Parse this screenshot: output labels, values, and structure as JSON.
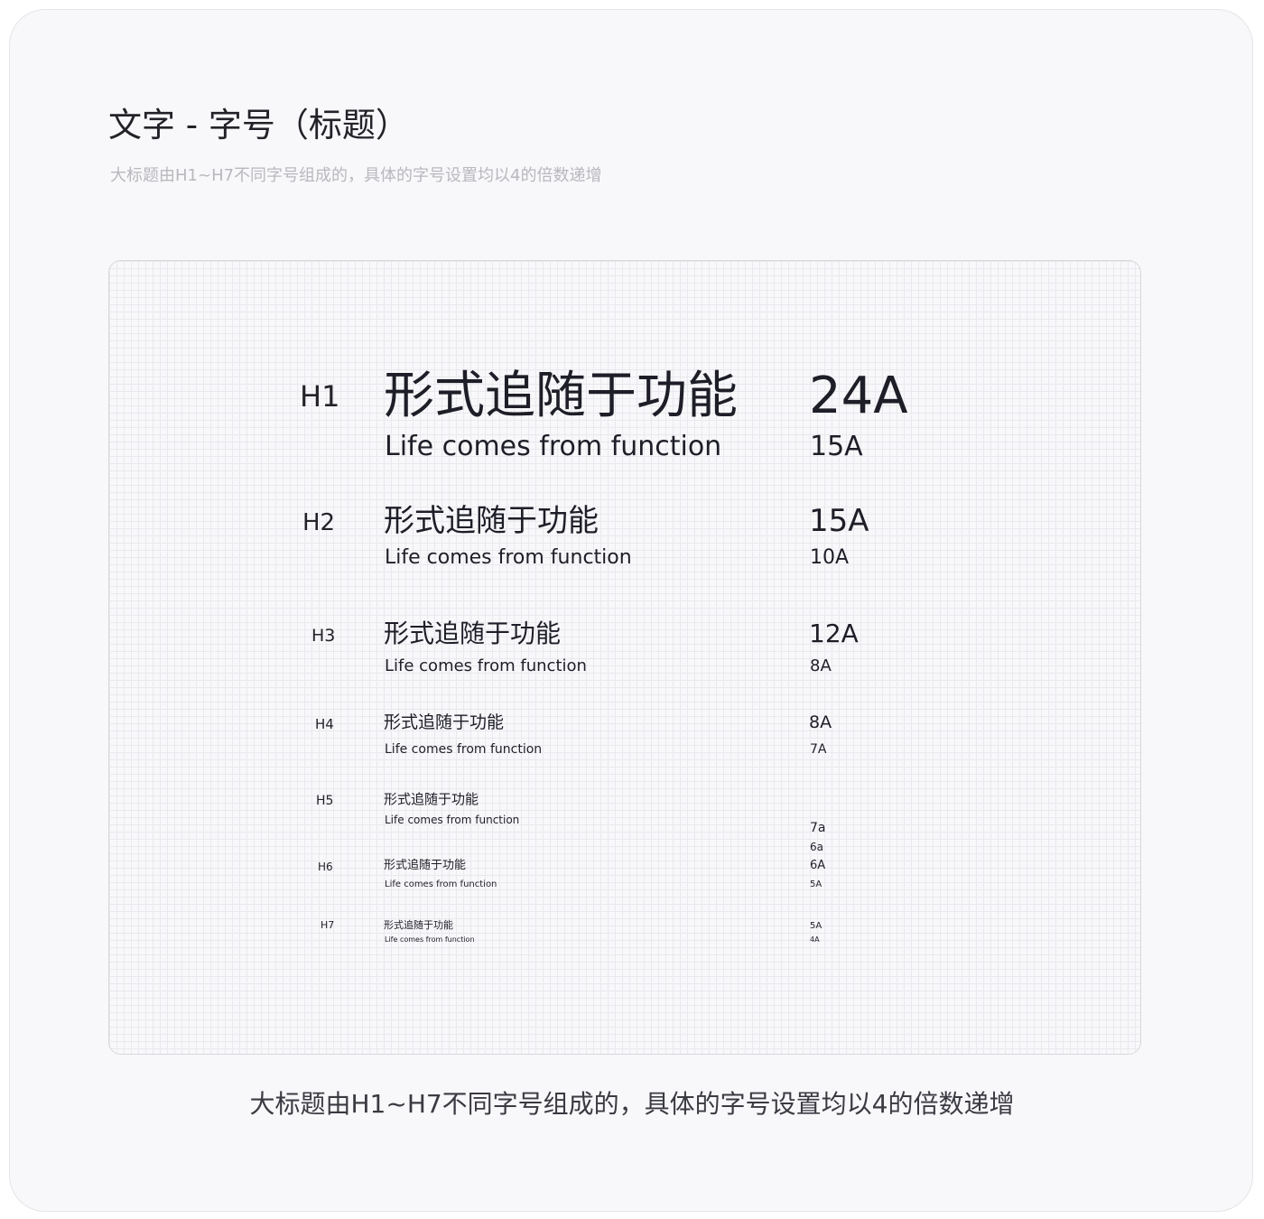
{
  "header": {
    "title": "文字 - 字号（标题）",
    "subtitle": "大标题由H1~H7不同字号组成的，具体的字号设置均以4的倍数递增"
  },
  "rows": [
    {
      "level": "H1",
      "zh": "形式追随于功能",
      "en": "Life comes from function",
      "zh_size": "24A",
      "en_size": "15A"
    },
    {
      "level": "H2",
      "zh": "形式追随于功能",
      "en": "Life comes from function",
      "zh_size": "15A",
      "en_size": "10A"
    },
    {
      "level": "H3",
      "zh": "形式追随于功能",
      "en": "Life comes from function",
      "zh_size": "12A",
      "en_size": "8A"
    },
    {
      "level": "H4",
      "zh": "形式追随于功能",
      "en": "Life comes from function",
      "zh_size": "8A",
      "en_size": "7A"
    },
    {
      "level": "H5",
      "zh": "形式追随于功能",
      "en": "Life comes from function",
      "zh_size": "7a",
      "en_size": "6a"
    },
    {
      "level": "H6",
      "zh": "形式追随于功能",
      "en": "Life comes from function",
      "zh_size": "6A",
      "en_size": "5A"
    },
    {
      "level": "H7",
      "zh": "形式追随于功能",
      "en": "Life comes from function",
      "zh_size": "5A",
      "en_size": "4A"
    }
  ],
  "footer": {
    "caption": "大标题由H1~H7不同字号组成的，具体的字号设置均以4的倍数递增"
  }
}
